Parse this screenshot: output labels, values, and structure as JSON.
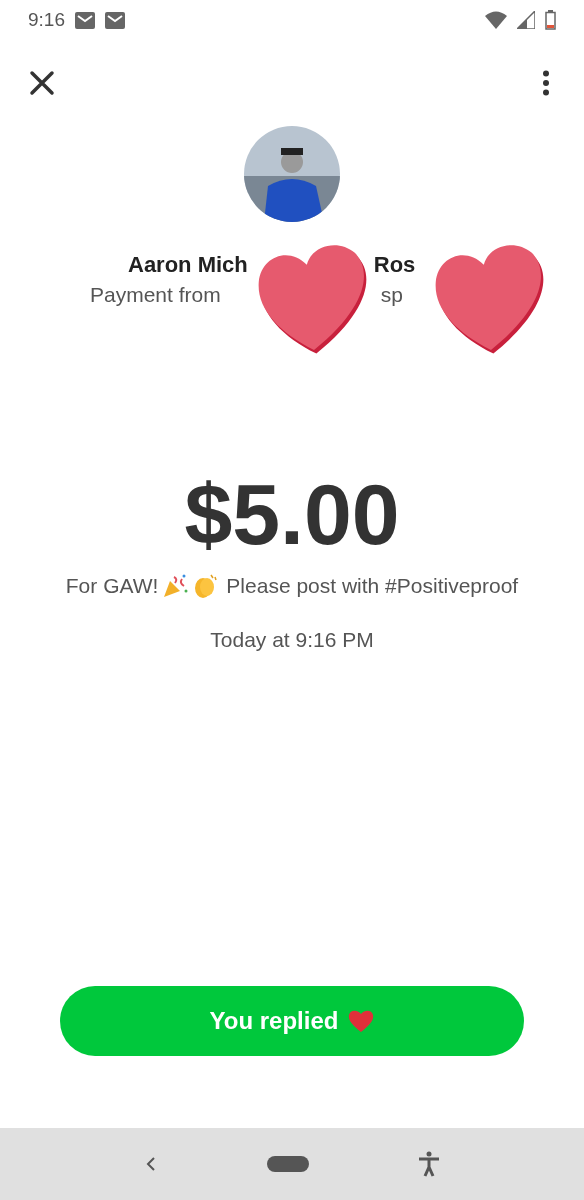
{
  "status_bar": {
    "time": "9:16"
  },
  "contact": {
    "name_visible_parts": [
      "Aaron Mich",
      "Ros"
    ],
    "subtitle_visible_parts": [
      "Payment from",
      "sp"
    ]
  },
  "payment": {
    "amount": "$5.00",
    "message_before": "For GAW!",
    "message_after": "Please post with #Positiveproof",
    "time": "Today at 9:16 PM"
  },
  "reply_button": {
    "label": "You replied"
  }
}
